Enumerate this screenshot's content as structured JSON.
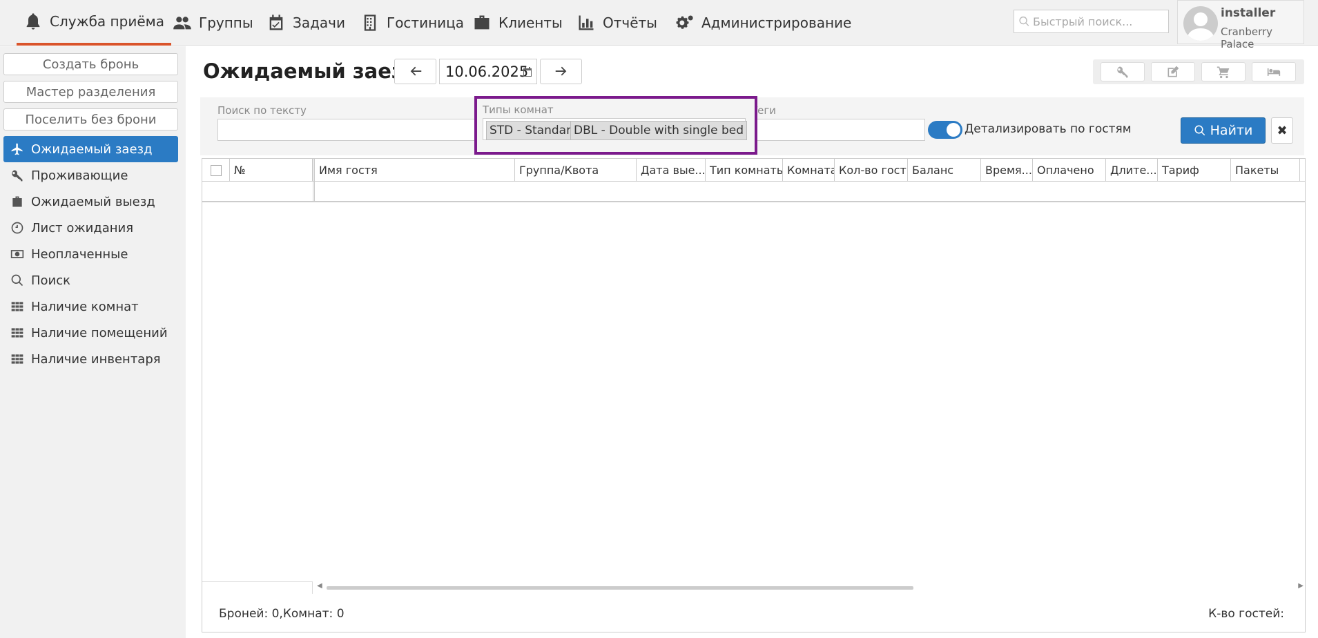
{
  "nav": {
    "items": [
      {
        "label": "Служба приёма",
        "icon": "bell-icon"
      },
      {
        "label": "Группы",
        "icon": "users-icon"
      },
      {
        "label": "Задачи",
        "icon": "calendar-check-icon"
      },
      {
        "label": "Гостиница",
        "icon": "building-icon"
      },
      {
        "label": "Клиенты",
        "icon": "briefcase-icon"
      },
      {
        "label": "Отчёты",
        "icon": "bar-chart-icon"
      },
      {
        "label": "Администрирование",
        "icon": "gears-icon"
      }
    ],
    "search_placeholder": "Быстрый поиск...",
    "user_name": "installer",
    "user_hotel": "Cranberry Palace"
  },
  "sidebar": {
    "buttons": [
      "Создать бронь",
      "Мастер разделения",
      "Поселить без брони"
    ],
    "items": [
      {
        "label": "Ожидаемый заезд",
        "icon": "plane-icon",
        "active": true
      },
      {
        "label": "Проживающие",
        "icon": "key-icon"
      },
      {
        "label": "Ожидаемый выезд",
        "icon": "suitcase-icon"
      },
      {
        "label": "Лист ожидания",
        "icon": "clock-icon"
      },
      {
        "label": "Неоплаченные",
        "icon": "money-icon"
      },
      {
        "label": "Поиск",
        "icon": "search-icon"
      },
      {
        "label": "Наличие комнат",
        "icon": "grid-icon"
      },
      {
        "label": "Наличие помещений",
        "icon": "grid-icon"
      },
      {
        "label": "Наличие инвентаря",
        "icon": "grid-icon"
      }
    ]
  },
  "main": {
    "title": "Ожидаемый заезд",
    "date": "10.06.2025"
  },
  "filters": {
    "text_search_label": "Поиск по тексту",
    "room_types_label": "Типы комнат",
    "room_types_selected": [
      "STD - Standard",
      "DBL - Double with single bed"
    ],
    "tags_label": "Теги",
    "detail_toggle_label": "Детализировать по гостям",
    "detail_toggle_on": true,
    "find_label": "Найти"
  },
  "grid": {
    "columns": [
      "№",
      "Имя гостя",
      "Группа/Квота",
      "Дата вые...",
      "Тип комнаты",
      "Комната",
      "Кол-во гост...",
      "Баланс",
      "Время...",
      "Оплачено",
      "Длите...",
      "Тариф",
      "Пакеты"
    ]
  },
  "footer": {
    "summary": "Броней: 0,Комнат: 0",
    "guests": "К-во гостей:"
  },
  "colors": {
    "accent": "#2b7bc4",
    "highlight": "#7b1a8c",
    "active_tab": "#d9542b"
  }
}
